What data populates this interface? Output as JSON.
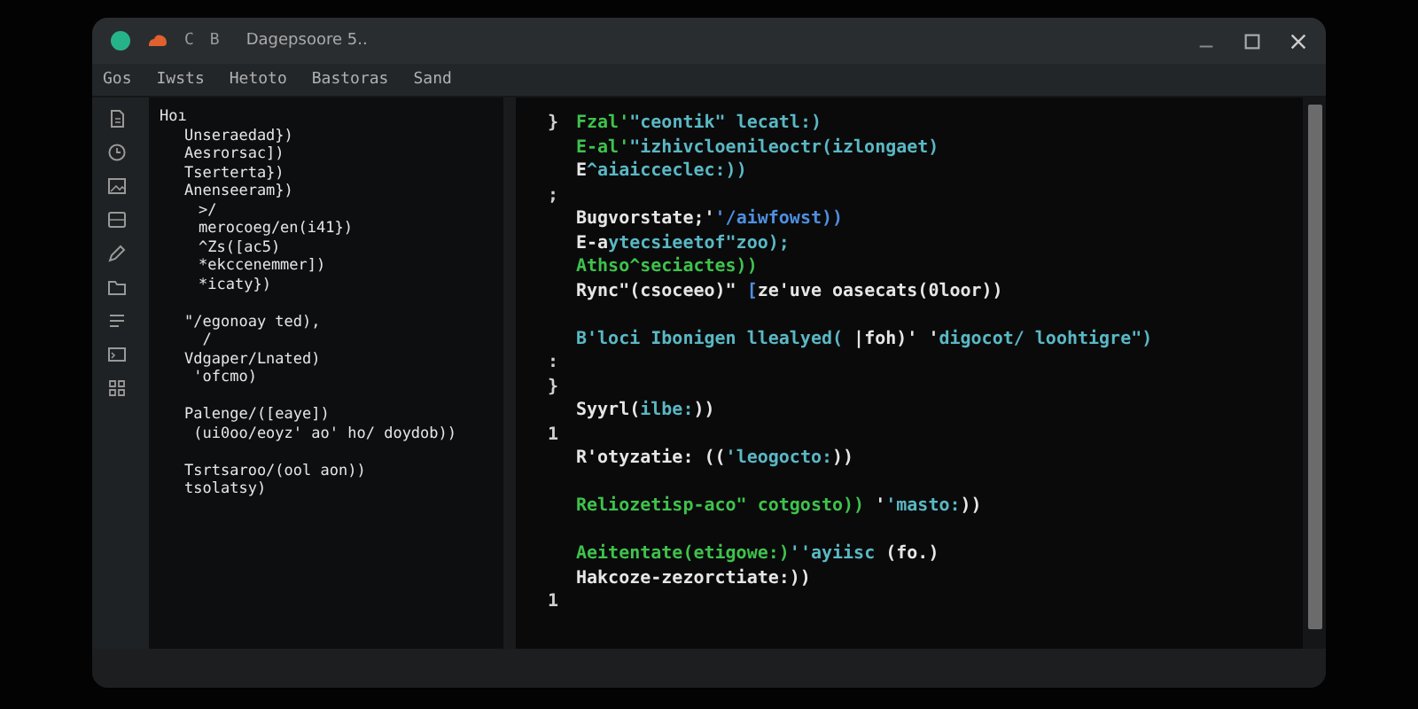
{
  "window": {
    "title": "Dagepsoore 5..",
    "title_glyphs": [
      "C",
      "B"
    ]
  },
  "menu": [
    "Gos",
    "Iwsts",
    "Hetoto",
    "Bastoras",
    "Sand"
  ],
  "outline": [
    {
      "kind": "line",
      "text": "Hoı",
      "children": [
        {
          "kind": "line",
          "text": "Unseraedad})"
        },
        {
          "kind": "line",
          "text": "Aesrorsac])"
        },
        {
          "kind": "line",
          "text": "Tserterta})"
        },
        {
          "kind": "line",
          "text": "Anenseeram})",
          "children": [
            {
              "kind": "line",
              "text": ">/"
            },
            {
              "kind": "line",
              "text": "merocoeg/en(i41})"
            },
            {
              "kind": "line",
              "text": "^Zs([ac5)"
            },
            {
              "kind": "line",
              "text": "*ekccenemmer])"
            },
            {
              "kind": "line",
              "text": "*icaty})"
            }
          ]
        },
        {
          "kind": "spacer"
        },
        {
          "kind": "line",
          "text": "\"/egonoay ted),"
        },
        {
          "kind": "line",
          "text": "  /"
        },
        {
          "kind": "line",
          "text": "Vdgaper/Lnated)"
        },
        {
          "kind": "line",
          "text": " 'ofcmo)"
        },
        {
          "kind": "spacer"
        },
        {
          "kind": "line",
          "text": "Palenge/([eaye])"
        },
        {
          "kind": "line",
          "text": " (ui0oo/eoyz' ao' ho/ doydob))"
        },
        {
          "kind": "spacer"
        },
        {
          "kind": "line",
          "text": "Tsrtsaroo/(ool aon))"
        },
        {
          "kind": "line",
          "text": "tsolatsy)"
        }
      ]
    }
  ],
  "code": [
    {
      "kind": "line",
      "gutter": "}",
      "segments": [
        {
          "kind": "green",
          "text": "Fzal'"
        },
        {
          "kind": "cyan",
          "text": "\"ceontik\" lecatl:)"
        }
      ]
    },
    {
      "kind": "line",
      "segments": [
        {
          "kind": "green",
          "text": "E-al'"
        },
        {
          "kind": "cyan",
          "text": "\"izhivcloenileoctr(izlongaet)"
        }
      ]
    },
    {
      "kind": "line",
      "segments": [
        {
          "kind": "plain",
          "text": "E"
        },
        {
          "kind": "cyan",
          "text": "^aiaicceclec:))"
        }
      ]
    },
    {
      "kind": "line",
      "gutter": ";"
    },
    {
      "kind": "line",
      "segments": [
        {
          "kind": "plain",
          "text": "Bugvorstate;'"
        },
        {
          "kind": "blue",
          "text": "'/aiwfowst))"
        }
      ]
    },
    {
      "kind": "line",
      "segments": [
        {
          "kind": "plain",
          "text": "E-a"
        },
        {
          "kind": "cyan",
          "text": "ytecsieetof\"zoo);"
        }
      ]
    },
    {
      "kind": "line",
      "segments": [
        {
          "kind": "green",
          "text": "Athso^seciactes))"
        }
      ]
    },
    {
      "kind": "line",
      "segments": [
        {
          "kind": "plain",
          "text": "Rync\"(csoceeo)\" "
        },
        {
          "kind": "blue",
          "text": "["
        },
        {
          "kind": "plain",
          "text": "ze'uve oasecats(0loor))"
        }
      ]
    },
    {
      "kind": "spacer"
    },
    {
      "kind": "line",
      "segments": [
        {
          "kind": "cyan",
          "text": "B'loci Ibonigen llealyed( "
        },
        {
          "kind": "plain",
          "text": "|foh)' '"
        },
        {
          "kind": "cyan",
          "text": "digocot/ loohtigre\")"
        }
      ]
    },
    {
      "kind": "line",
      "gutter": ":"
    },
    {
      "kind": "line",
      "gutter": "}"
    },
    {
      "kind": "line",
      "segments": [
        {
          "kind": "plain",
          "text": "Syyrl("
        },
        {
          "kind": "cyan",
          "text": "ilbe:"
        },
        {
          "kind": "plain",
          "text": "))"
        }
      ]
    },
    {
      "kind": "line",
      "gutter": "1"
    },
    {
      "kind": "line",
      "segments": [
        {
          "kind": "plain",
          "text": "R'otyzatie: (("
        },
        {
          "kind": "cyan",
          "text": "'leogocto:"
        },
        {
          "kind": "plain",
          "text": "))"
        }
      ]
    },
    {
      "kind": "spacer"
    },
    {
      "kind": "line",
      "segments": [
        {
          "kind": "green",
          "text": "Reliozetisp-aco\" cotgosto))"
        },
        {
          "kind": "plain",
          "text": " '"
        },
        {
          "kind": "cyan",
          "text": "'masto:"
        },
        {
          "kind": "plain",
          "text": "))"
        }
      ]
    },
    {
      "kind": "spacer"
    },
    {
      "kind": "line",
      "segments": [
        {
          "kind": "green",
          "text": "Aeitentate(etigowe:)"
        },
        {
          "kind": "cyan",
          "text": "''ayiisc"
        },
        {
          "kind": "plain",
          "text": " (fo.)"
        }
      ]
    },
    {
      "kind": "line",
      "segments": [
        {
          "kind": "plain",
          "text": "Hakcoze-zezorctiate:))"
        }
      ]
    },
    {
      "kind": "line",
      "gutter": "1"
    }
  ]
}
